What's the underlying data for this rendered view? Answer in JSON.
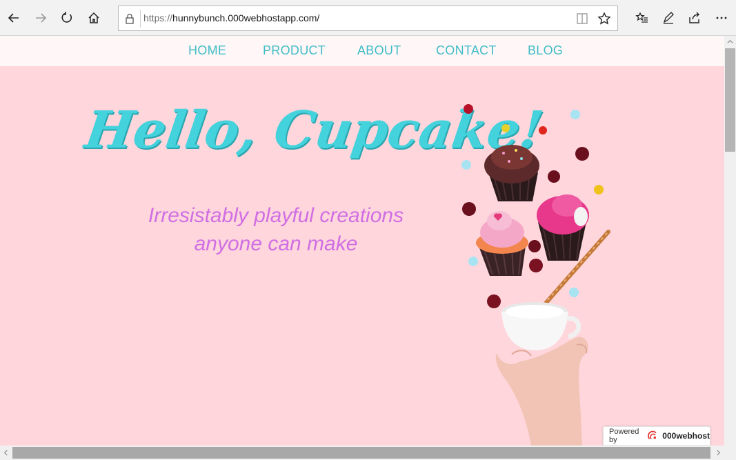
{
  "browser": {
    "url_scheme": "https://",
    "url_host": "hunnybunch.000webhostapp.com/"
  },
  "nav": {
    "items": [
      {
        "label": "HOME"
      },
      {
        "label": "PRODUCT"
      },
      {
        "label": "ABOUT"
      },
      {
        "label": "CONTACT"
      },
      {
        "label": "BLOG"
      }
    ]
  },
  "hero": {
    "title": "Hello, Cupcake!",
    "subtitle_line1": "Irresistably playful creations",
    "subtitle_line2": "anyone can make"
  },
  "footer_badge": {
    "label": "Powered by",
    "brand": "000webhost"
  },
  "colors": {
    "page_bg": "#ffd6dc",
    "nav_bg": "#fff7f7",
    "nav_text": "#3fbcc6",
    "title": "#44d2dc",
    "subtitle": "#d06ee4"
  }
}
